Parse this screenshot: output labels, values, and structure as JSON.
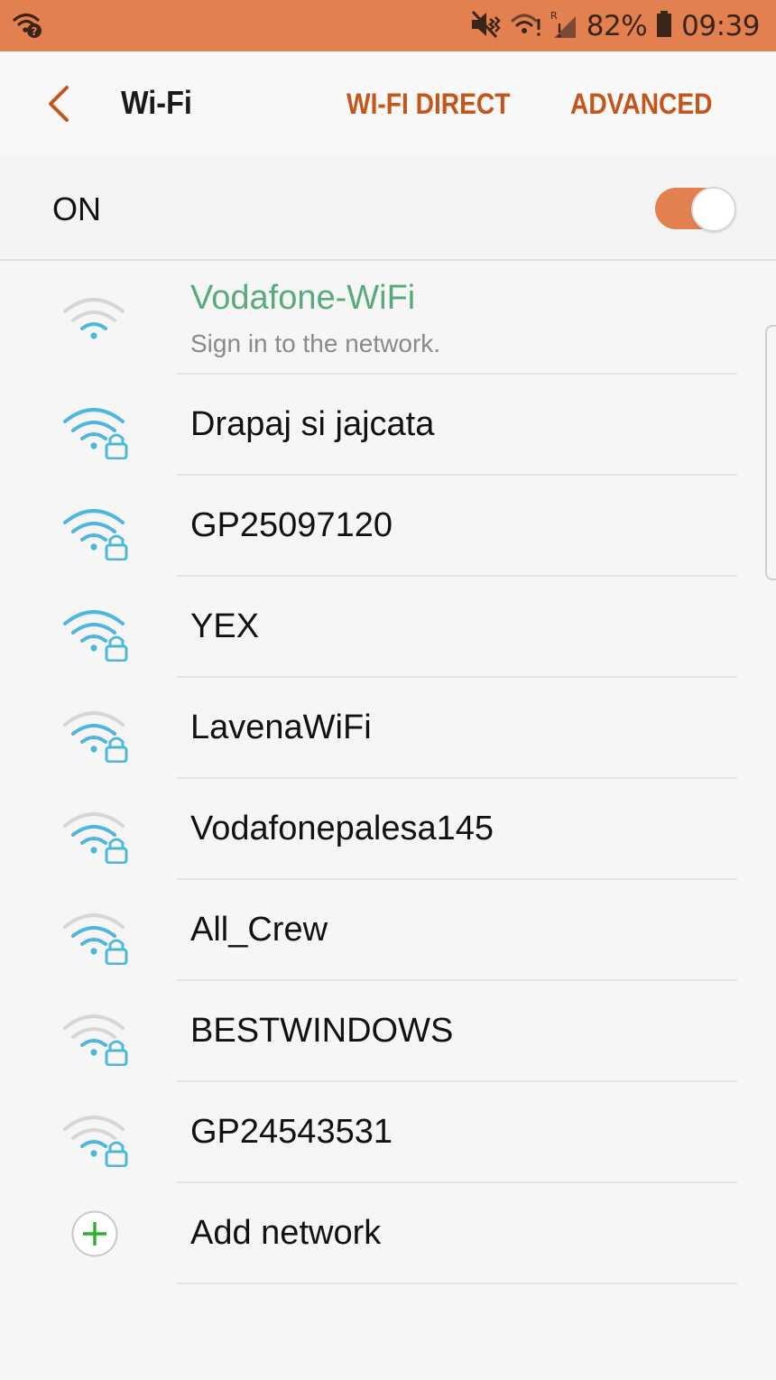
{
  "status_bar": {
    "battery": "82%",
    "time": "09:39",
    "left_icon": "wifi-question-icon",
    "icons": [
      "vibrate-mute-icon",
      "wifi-signal-icon",
      "roaming-signal-icon",
      "battery-icon"
    ]
  },
  "app_bar": {
    "back_icon": "chevron-left-icon",
    "title": "Wi-Fi",
    "wifi_direct": "WI-FI DIRECT",
    "advanced": "ADVANCED"
  },
  "toggle": {
    "label": "ON",
    "state": true
  },
  "networks": [
    {
      "name": "Vodafone-WiFi",
      "subtitle": "Sign in to the network.",
      "secured": false,
      "signal": 1
    },
    {
      "name": "Drapaj si jajcata",
      "secured": true,
      "signal": 3
    },
    {
      "name": "GP25097120",
      "secured": true,
      "signal": 3
    },
    {
      "name": "YEX",
      "secured": true,
      "signal": 3
    },
    {
      "name": "LavenaWiFi",
      "secured": true,
      "signal": 2
    },
    {
      "name": "Vodafonepalesa145",
      "secured": true,
      "signal": 2
    },
    {
      "name": "All_Crew",
      "secured": true,
      "signal": 2
    },
    {
      "name": "BESTWINDOWS",
      "secured": true,
      "signal": 1
    },
    {
      "name": "GP24543531",
      "secured": true,
      "signal": 1
    }
  ],
  "add_network": {
    "label": "Add network",
    "icon": "plus-circle-icon"
  },
  "colors": {
    "accent": "#e3804f",
    "action_text": "#c5561b",
    "connected_text": "#58ab79",
    "wifi_active": "#4fb6dd",
    "wifi_inactive": "#d6d6d6",
    "add_plus": "#2fae2f"
  }
}
